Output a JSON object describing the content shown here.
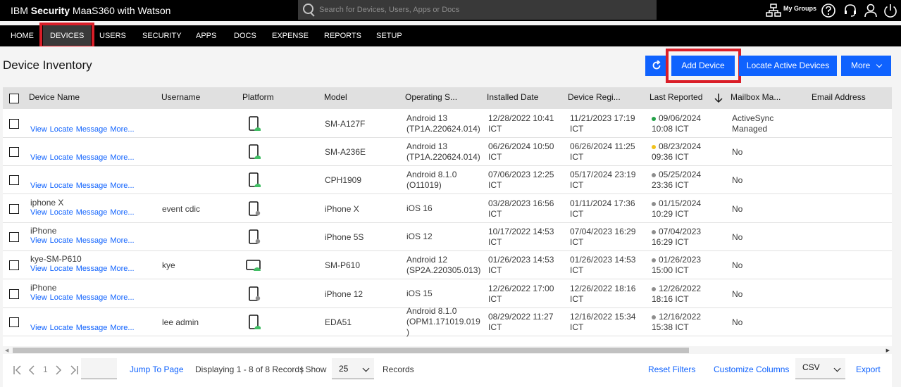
{
  "header": {
    "brand_prefix": "IBM",
    "brand_bold": "Security",
    "brand_rest": "MaaS360 with Watson",
    "search_placeholder": "Search for Devices, Users, Apps or Docs",
    "my_groups": "My Groups"
  },
  "nav": {
    "items": [
      "HOME",
      "DEVICES",
      "USERS",
      "SECURITY",
      "APPS",
      "DOCS",
      "EXPENSE",
      "REPORTS",
      "SETUP"
    ],
    "active": "DEVICES"
  },
  "page": {
    "title": "Device Inventory",
    "buttons": {
      "add_device": "Add Device",
      "locate_active": "Locate Active Devices",
      "more": "More"
    }
  },
  "table": {
    "columns": [
      "Device Name",
      "Username",
      "Platform",
      "Model",
      "Operating S...",
      "Installed Date",
      "Device Regi...",
      "Last Reported",
      "Mailbox Ma...",
      "Email Address"
    ],
    "actions": [
      "View",
      "Locate",
      "Message",
      "More..."
    ],
    "rows": [
      {
        "name": "",
        "username": "",
        "platform": "android",
        "model": "SM-A127F",
        "os1": "Android 13",
        "os2": "(TP1A.220624.014)",
        "os3": "",
        "installed1": "12/28/2022 10:41",
        "installed2": "ICT",
        "reg1": "11/21/2023 17:19",
        "reg2": "ICT",
        "status": "green",
        "last1": "09/06/2024",
        "last2": "10:08 ICT",
        "mailbox1": "ActiveSync",
        "mailbox2": "Managed"
      },
      {
        "name": "",
        "username": "",
        "platform": "android",
        "model": "SM-A236E",
        "os1": "Android 13",
        "os2": "(TP1A.220624.014)",
        "os3": "",
        "installed1": "06/26/2024 10:50",
        "installed2": "ICT",
        "reg1": "06/26/2024 11:25",
        "reg2": "ICT",
        "status": "yellow",
        "last1": "08/23/2024",
        "last2": "09:36 ICT",
        "mailbox1": "No",
        "mailbox2": ""
      },
      {
        "name": "",
        "username": "",
        "platform": "android",
        "model": "CPH1909",
        "os1": "Android 8.1.0",
        "os2": "(O11019)",
        "os3": "",
        "installed1": "07/06/2023 12:25",
        "installed2": "ICT",
        "reg1": "05/17/2024 23:19",
        "reg2": "ICT",
        "status": "gray",
        "last1": "05/25/2024",
        "last2": "23:36 ICT",
        "mailbox1": "No",
        "mailbox2": ""
      },
      {
        "name": "iphone X",
        "username": "event cdic",
        "platform": "apple",
        "model": "iPhone X",
        "os1": "iOS 16",
        "os2": "",
        "os3": "",
        "installed1": "03/28/2023 16:56",
        "installed2": "ICT",
        "reg1": "01/11/2024 17:36",
        "reg2": "ICT",
        "status": "gray",
        "last1": "01/15/2024",
        "last2": "10:29 ICT",
        "mailbox1": "No",
        "mailbox2": ""
      },
      {
        "name": "iPhone",
        "username": "",
        "platform": "apple",
        "model": "iPhone 5S",
        "os1": "iOS 12",
        "os2": "",
        "os3": "",
        "installed1": "10/17/2022 14:53",
        "installed2": "ICT",
        "reg1": "07/04/2023 16:29",
        "reg2": "ICT",
        "status": "gray",
        "last1": "07/04/2023",
        "last2": "16:29 ICT",
        "mailbox1": "No",
        "mailbox2": ""
      },
      {
        "name": "kye-SM-P610",
        "username": "kye",
        "platform": "android-tablet",
        "model": "SM-P610",
        "os1": "Android 12",
        "os2": "(SP2A.220305.013)",
        "os3": "",
        "installed1": "01/26/2023 14:53",
        "installed2": "ICT",
        "reg1": "01/26/2023 14:53",
        "reg2": "ICT",
        "status": "gray",
        "last1": "01/26/2023",
        "last2": "15:00 ICT",
        "mailbox1": "No",
        "mailbox2": ""
      },
      {
        "name": "iPhone",
        "username": "",
        "platform": "apple",
        "model": "iPhone 12",
        "os1": "iOS 15",
        "os2": "",
        "os3": "",
        "installed1": "12/26/2022 17:00",
        "installed2": "ICT",
        "reg1": "12/26/2022 18:16",
        "reg2": "ICT",
        "status": "gray",
        "last1": "12/26/2022",
        "last2": "18:16 ICT",
        "mailbox1": "No",
        "mailbox2": ""
      },
      {
        "name": "",
        "username": "lee admin",
        "platform": "android",
        "model": "EDA51",
        "os1": "Android 8.1.0",
        "os2": "(OPM1.171019.019",
        "os3": ")",
        "installed1": "08/29/2022 11:27",
        "installed2": "ICT",
        "reg1": "12/16/2022 15:34",
        "reg2": "ICT",
        "status": "gray",
        "last1": "12/16/2022",
        "last2": "15:38 ICT",
        "mailbox1": "No",
        "mailbox2": ""
      }
    ]
  },
  "pager": {
    "page": "1",
    "jump": "Jump To Page",
    "displaying": "Displaying 1 - 8 of 8 Records",
    "show": "| Show",
    "per_page": "25",
    "records": "Records",
    "reset": "Reset Filters",
    "customize": "Customize Columns",
    "format": "CSV",
    "export": "Export"
  },
  "colors": {
    "accent": "#0f62fe",
    "highlight": "#da1e28",
    "android_green": "#42be65",
    "status_green": "#24a148",
    "status_yellow": "#f1c21b",
    "status_gray": "#8d8d8d"
  }
}
